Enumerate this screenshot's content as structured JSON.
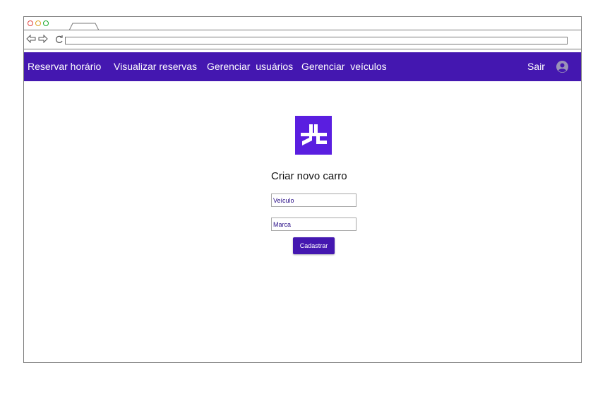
{
  "navbar": {
    "items": [
      {
        "label": "Reservar horário"
      },
      {
        "label": "Visualizar reservas"
      },
      {
        "label": "Gerenciar  usuários"
      },
      {
        "label": "Gerenciar  veículos"
      }
    ],
    "logout_label": "Sair",
    "avatar_icon": "user-circle-icon",
    "bg_color": "#4417b0"
  },
  "form": {
    "title": "Criar novo carro",
    "vehicle_placeholder": "Veículo",
    "brand_placeholder": "Marca",
    "submit_label": "Cadastrar"
  },
  "logo": {
    "icon": "brand-logo-icon",
    "color": "#5a1ee0"
  }
}
